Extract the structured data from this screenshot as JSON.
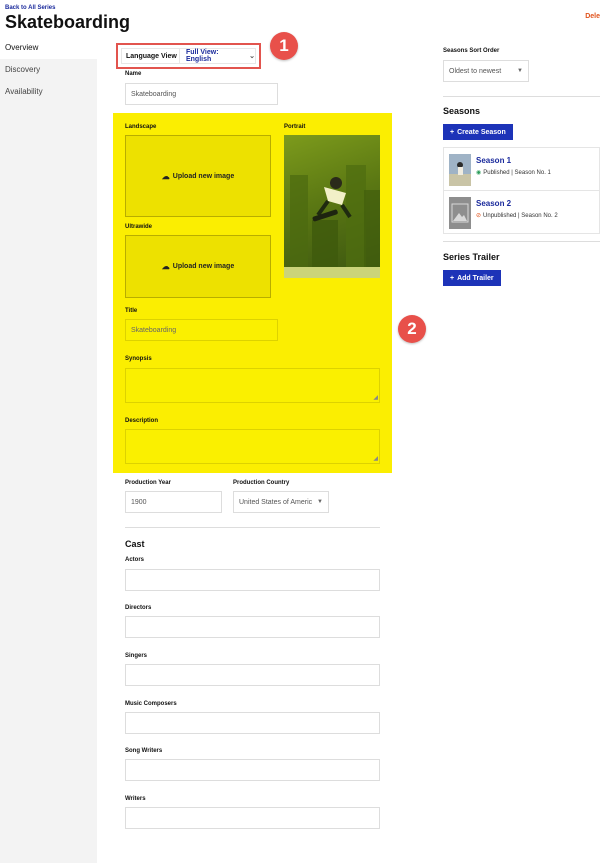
{
  "header": {
    "back_link": "Back to All Series",
    "title": "Skateboarding",
    "delete_link": "Dele"
  },
  "sidebar": {
    "items": [
      {
        "label": "Overview",
        "active": true
      },
      {
        "label": "Discovery",
        "active": false
      },
      {
        "label": "Availability",
        "active": false
      }
    ]
  },
  "language": {
    "label": "Language View",
    "value": "Full View: English"
  },
  "callouts": {
    "one": "1",
    "two": "2"
  },
  "name_field": {
    "label": "Name",
    "value": "Skateboarding"
  },
  "localized": {
    "landscape_label": "Landscape",
    "portrait_label": "Portrait",
    "ultrawide_label": "Ultrawide",
    "upload_label": "Upload new image",
    "title_label": "Title",
    "title_value": "Skateboarding",
    "synopsis_label": "Synopsis",
    "description_label": "Description",
    "highlight_color": "#fbee01"
  },
  "production": {
    "year_label": "Production Year",
    "year_value": "1900",
    "country_label": "Production Country",
    "country_value": "United States of Americ"
  },
  "cast": {
    "title": "Cast",
    "fields": [
      "Actors",
      "Directors",
      "Singers",
      "Music Composers",
      "Song Writers",
      "Writers"
    ]
  },
  "seasons_sort": {
    "label": "Seasons Sort Order",
    "value": "Oldest to newest"
  },
  "seasons": {
    "title": "Seasons",
    "create_button": "Create Season",
    "items": [
      {
        "name": "Season 1",
        "status": "Published",
        "season_no": "Season No. 1",
        "status_icon": "published-icon"
      },
      {
        "name": "Season 2",
        "status": "Unpublished",
        "season_no": "Season No. 2",
        "status_icon": "unpublished-icon"
      }
    ],
    "separator": " | "
  },
  "trailer": {
    "title": "Series Trailer",
    "add_button": "Add Trailer"
  },
  "colors": {
    "accent_blue": "#1d33b8",
    "callout_red": "#e8504a"
  }
}
